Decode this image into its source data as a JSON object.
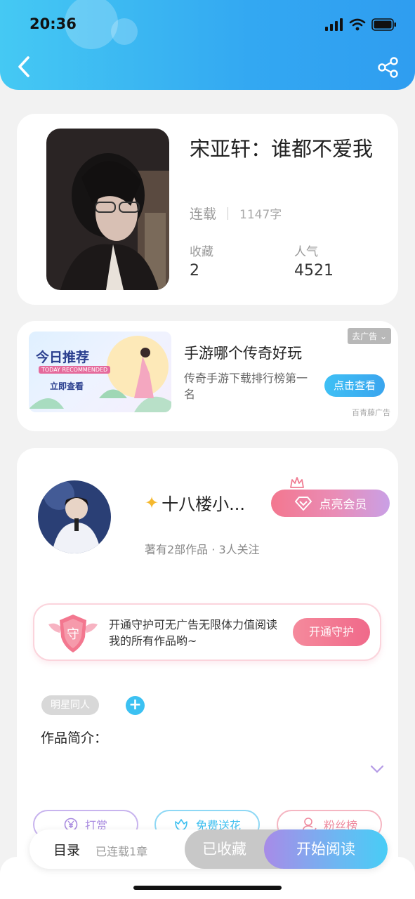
{
  "status_bar": {
    "time": "20:36"
  },
  "book": {
    "title": "宋亚轩：谁都不爱我",
    "status": "连载",
    "word_count": "1147字",
    "favorites_label": "收藏",
    "favorites_value": "2",
    "popularity_label": "人气",
    "popularity_value": "4521"
  },
  "ad": {
    "image_title": "今日推荐",
    "image_subtitle": "TODAY RECOMMENDED",
    "image_cta": "立即查看",
    "close_label": "去广告",
    "title": "手游哪个传奇好玩",
    "description": "传奇手游下载排行榜第一名",
    "button": "点击查看",
    "source": "百青藤广告"
  },
  "author": {
    "name": "十八楼小...",
    "vip_button": "点亮会员",
    "meta": "著有2部作品 · 3人关注",
    "guard_text": "开通守护可无广告无限体力值阅读我的所有作品哟~",
    "guard_badge": "守",
    "guard_button": "开通守护"
  },
  "tags": [
    "明星同人"
  ],
  "intro_label": "作品简介：",
  "actions": [
    {
      "label": "打赏",
      "icon": "yen-icon",
      "color": "#a98be0"
    },
    {
      "label": "免费送花",
      "icon": "flower-icon",
      "color": "#3fc0f0"
    },
    {
      "label": "粉丝榜",
      "icon": "fans-icon",
      "color": "#ef8a9e"
    }
  ],
  "bottom_bar": {
    "toc": "目录",
    "toc_status": "已连载1章",
    "favorited": "已收藏",
    "start_reading": "开始阅读"
  },
  "colors": {
    "header_start": "#45c9f3",
    "header_end": "#2f9df0",
    "accent_blue": "#3cc1f2",
    "vip_pink": "#f3778f",
    "guard_pink": "#f0698a"
  }
}
